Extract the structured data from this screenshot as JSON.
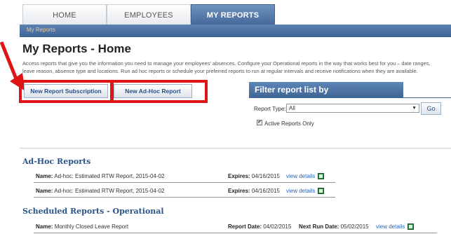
{
  "tabs": [
    {
      "label": "HOME",
      "active": false
    },
    {
      "label": "EMPLOYEES",
      "active": false
    },
    {
      "label": "MY REPORTS",
      "active": true
    }
  ],
  "breadcrumb": "My Reports",
  "page_title": "My Reports - Home",
  "description": "Access reports that give you the information you need to manage your employees' absences. Configure your Operational reports in the way that works best for you – date ranges, leave reason, absence type and locations. Run ad hoc reports or schedule your preferred reports to run at regular intervals and receive notifications when they are available.",
  "buttons": {
    "new_subscription": "New Report Subscription",
    "new_adhoc": "New Ad-Hoc Report"
  },
  "filter": {
    "title": "Filter report list by",
    "report_type_label": "Report Type:",
    "report_type_value": "All",
    "go_label": "Go",
    "active_only_label": "Active Reports Only",
    "active_only_checked": true
  },
  "adhoc": {
    "title": "Ad-Hoc Reports",
    "rows": [
      {
        "name_label": "Name:",
        "name": "Ad-hoc: Estimated RTW Report, 2015-04-02",
        "expires_label": "Expires:",
        "expires": "04/16/2015",
        "link": "view details"
      },
      {
        "name_label": "Name:",
        "name": "Ad-hoc: Estimated RTW Report, 2015-04-02",
        "expires_label": "Expires:",
        "expires": "04/16/2015",
        "link": "view details"
      }
    ]
  },
  "scheduled": {
    "title": "Scheduled Reports - Operational",
    "rows": [
      {
        "name_label": "Name:",
        "name": "Monthly Closed Leave Report",
        "report_date_label": "Report Date:",
        "report_date": "04/02/2015",
        "next_run_label": "Next Run Date:",
        "next_run": "05/02/2015",
        "link": "view details"
      }
    ]
  },
  "colors": {
    "accent": "#43689a",
    "highlight": "#e01414",
    "link": "#2a63b8"
  }
}
